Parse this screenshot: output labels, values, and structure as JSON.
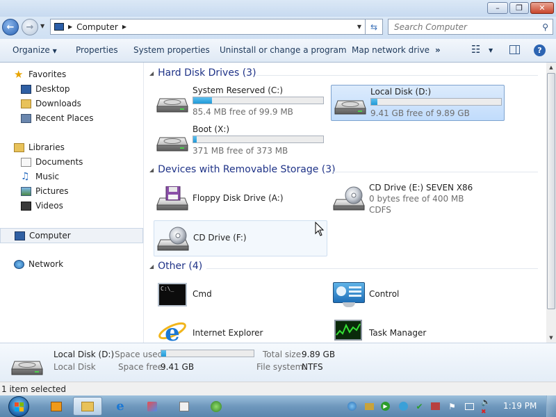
{
  "window": {
    "minimize_glyph": "–",
    "maximize_glyph": "❐",
    "close_glyph": "✕"
  },
  "address": {
    "location": "Computer",
    "refresh_glyph": "⇆",
    "search_placeholder": "Search Computer"
  },
  "commands": {
    "organize": "Organize",
    "properties": "Properties",
    "system_properties": "System properties",
    "uninstall": "Uninstall or change a program",
    "map_drive": "Map network drive",
    "more": "»",
    "views_glyph": "☷",
    "help": "?"
  },
  "nav": {
    "favorites": "Favorites",
    "desktop": "Desktop",
    "downloads": "Downloads",
    "recent_places": "Recent Places",
    "libraries": "Libraries",
    "documents": "Documents",
    "music": "Music",
    "pictures": "Pictures",
    "videos": "Videos",
    "computer": "Computer",
    "network": "Network"
  },
  "groups": {
    "hard_disks": "Hard Disk Drives (3)",
    "removable": "Devices with Removable Storage (3)",
    "other": "Other (4)"
  },
  "drives": {
    "sysres": {
      "name": "System Reserved (C:)",
      "free": "85.4 MB free of 99.9 MB",
      "used_fraction": 0.145
    },
    "local_d": {
      "name": "Local Disk (D:)",
      "free": "9.41 GB free of 9.89 GB",
      "used_fraction": 0.05
    },
    "boot": {
      "name": "Boot (X:)",
      "free": "371 MB free of 373 MB",
      "used_fraction": 0.006
    },
    "floppy": {
      "name": "Floppy Disk Drive (A:)"
    },
    "cd_e": {
      "name": "CD Drive (E:) SEVEN X86",
      "free": "0 bytes free of 400 MB",
      "fs": "CDFS"
    },
    "cd_f": {
      "name": "CD Drive (F:)"
    }
  },
  "other_items": {
    "cmd": "Cmd",
    "control": "Control",
    "ie": "Internet Explorer",
    "taskmgr": "Task Manager",
    "cmd_prompt": "C:\\_"
  },
  "details": {
    "name": "Local Disk (D:)",
    "type": "Local Disk",
    "space_used_label": "Space used:",
    "space_free_label": "Space free:",
    "space_free": "9.41 GB",
    "total_label": "Total size:",
    "total": "9.89 GB",
    "fs_label": "File system:",
    "fs": "NTFS",
    "used_fraction": 0.05
  },
  "status": {
    "text": "1 item selected"
  },
  "taskbar": {
    "clock": "1:19 PM"
  },
  "colors": {
    "accent": "#1e3287",
    "bar_fill": "#1f9ad8",
    "selection": "#c1dcfc"
  }
}
